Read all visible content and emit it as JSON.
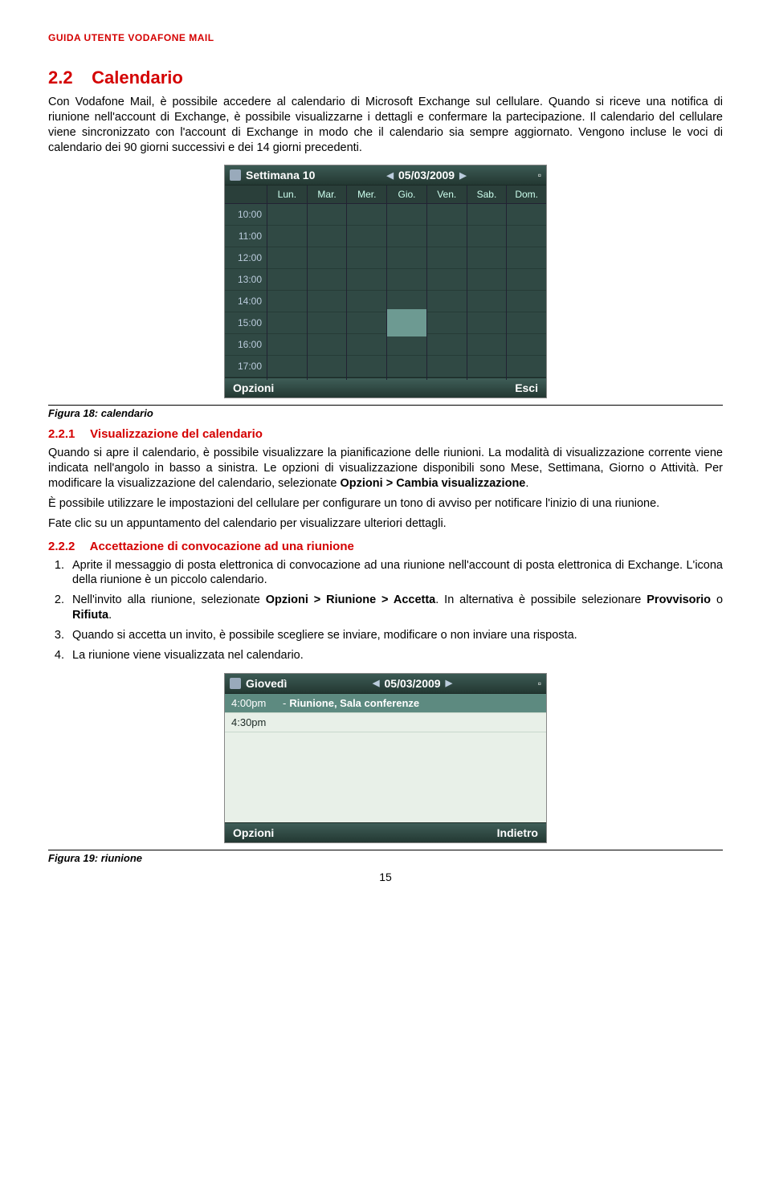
{
  "header": "GUIDA UTENTE VODAFONE MAIL",
  "s22": {
    "num": "2.2",
    "title": "Calendario",
    "p1": "Con Vodafone Mail, è possibile accedere al calendario di Microsoft Exchange sul cellulare. Quando si riceve una notifica di riunione nell'account di Exchange, è possibile visualizzarne i dettagli e confermare la partecipazione. Il calendario del cellulare viene sincronizzato con l'account di Exchange in modo che il calendario sia sempre aggiornato. Vengono incluse le voci di calendario dei 90 giorni successivi e dei 14 giorni precedenti."
  },
  "phone1": {
    "title": "Settimana 10",
    "date": "05/03/2009",
    "days": [
      "Lun.",
      "Mar.",
      "Mer.",
      "Gio.",
      "Ven.",
      "Sab.",
      "Dom."
    ],
    "hours": [
      "10:00",
      "11:00",
      "12:00",
      "13:00",
      "14:00",
      "15:00",
      "16:00",
      "17:00"
    ],
    "left_soft": "Opzioni",
    "right_soft": "Esci"
  },
  "fig18": "Figura 18: calendario",
  "s221": {
    "num": "2.2.1",
    "title": "Visualizzazione del calendario",
    "p1a": "Quando si apre il calendario, è possibile visualizzare la pianificazione delle riunioni. La modalità di visualizzazione corrente viene indicata nell'angolo in basso a sinistra. Le opzioni di visualizzazione disponibili sono Mese, Settimana, Giorno o Attività. Per modificare la visualizzazione del calendario, selezionate ",
    "p1b": "Opzioni > Cambia visualizzazione",
    "p1c": ".",
    "p2": "È possibile utilizzare le impostazioni del cellulare per configurare un tono di avviso per notificare l'inizio di una riunione.",
    "p3": "Fate clic su un appuntamento del calendario per visualizzare ulteriori dettagli."
  },
  "s222": {
    "num": "2.2.2",
    "title": "Accettazione di  convocazione ad una riunione",
    "li1": "Aprite il messaggio di posta elettronica di convocazione ad una riunione nell'account di posta elettronica di Exchange. L'icona della riunione è un piccolo calendario.",
    "li2a": "Nell'invito alla riunione, selezionate ",
    "li2b": "Opzioni > Riunione > Accetta",
    "li2c": ". In alternativa è possibile selezionare ",
    "li2d": "Provvisorio",
    "li2e": " o ",
    "li2f": "Rifiuta",
    "li2g": ".",
    "li3": "Quando si accetta un invito, è possibile scegliere se inviare, modificare o non inviare una risposta.",
    "li4": "La riunione viene visualizzata nel calendario."
  },
  "phone2": {
    "title": "Giovedì",
    "date": "05/03/2009",
    "ev1_time": "4:00pm",
    "ev1_text": "Riunione, Sala conferenze",
    "ev2_time": "4:30pm",
    "left_soft": "Opzioni",
    "right_soft": "Indietro"
  },
  "fig19": "Figura 19: riunione",
  "page_num": "15"
}
